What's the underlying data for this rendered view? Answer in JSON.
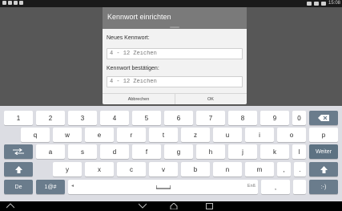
{
  "status_bar": {
    "time": "15:08",
    "icons_left": [
      "notification-icon",
      "image-icon",
      "mail-icon",
      "alarm-icon"
    ],
    "icons_right": [
      "signal-icon",
      "wifi-icon",
      "battery-icon"
    ]
  },
  "dialog": {
    "title": "Kennwort einrichten",
    "new_label": "Neues Kennwort:",
    "new_placeholder": "4 - 12 Zeichen",
    "confirm_label": "Kennwort bestätigen:",
    "confirm_placeholder": "4 - 12 Zeichen",
    "cancel_label": "Abbrechen",
    "ok_label": "OK"
  },
  "keyboard": {
    "row1": [
      "1",
      "2",
      "3",
      "4",
      "5",
      "6",
      "7",
      "8",
      "9",
      "0"
    ],
    "row2": [
      "q",
      "w",
      "e",
      "r",
      "t",
      "z",
      "u",
      "i",
      "o",
      "p",
      "-"
    ],
    "row3": [
      "a",
      "s",
      "d",
      "f",
      "g",
      "h",
      "j",
      "k",
      "l"
    ],
    "row4": [
      "y",
      "x",
      "c",
      "v",
      "b",
      "n",
      "m",
      ",",
      "."
    ],
    "weiter_label": "Weiter",
    "lang_label": "De",
    "symbols_label": "1@#",
    "space_lang_label": "Enß",
    "comma_label": ",",
    "smiley_label": ":-)",
    "accent_color": "#6a7c8c"
  },
  "navbar": {
    "icons": [
      "back-icon",
      "hide-keyboard-icon",
      "home-icon",
      "recents-icon"
    ]
  }
}
